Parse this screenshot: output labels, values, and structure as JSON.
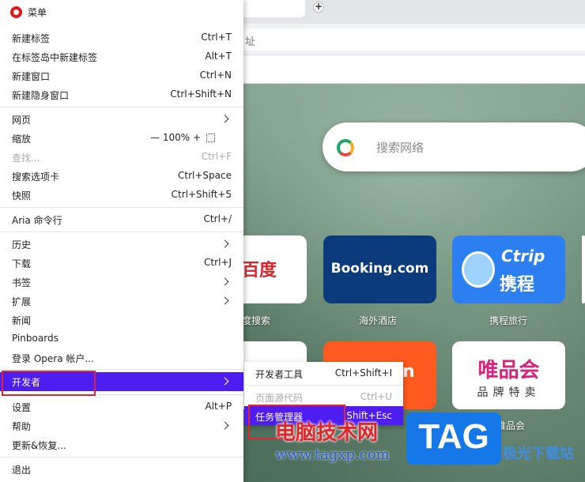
{
  "background": {
    "address_hint": "址",
    "search_placeholder": "搜索网络",
    "tiles": {
      "baidu": {
        "logo_text": "百度",
        "label": "度搜索"
      },
      "booking": {
        "logo_text": "Booking.com",
        "label": "海外酒店"
      },
      "ctrip": {
        "logo_en": "Ctrip",
        "logo_cn": "携程",
        "label": "携程旅行"
      },
      "orange": {
        "logo_text": "n"
      },
      "vip": {
        "logo_text": "唯品会",
        "sub_text": "品牌特卖",
        "label": "唯品会"
      }
    }
  },
  "menu": {
    "title": "菜单",
    "items": [
      {
        "label": "新建标签",
        "shortcut": "Ctrl+T"
      },
      {
        "label": "在标签岛中新建标签",
        "shortcut": "Alt+T"
      },
      {
        "label": "新建窗口",
        "shortcut": "Ctrl+N"
      },
      {
        "label": "新建隐身窗口",
        "shortcut": "Ctrl+Shift+N"
      },
      {
        "label": "网页",
        "shortcut": ""
      },
      {
        "label": "缩放",
        "shortcut": ""
      },
      {
        "label": "查找...",
        "shortcut": "Ctrl+F"
      },
      {
        "label": "搜索选项卡",
        "shortcut": "Ctrl+Space"
      },
      {
        "label": "快照",
        "shortcut": "Ctrl+Shift+5"
      },
      {
        "label": "Aria 命令行",
        "shortcut": "Ctrl+/"
      },
      {
        "label": "历史",
        "shortcut": ""
      },
      {
        "label": "下载",
        "shortcut": "Ctrl+J"
      },
      {
        "label": "书签",
        "shortcut": ""
      },
      {
        "label": "扩展",
        "shortcut": ""
      },
      {
        "label": "新闻",
        "shortcut": ""
      },
      {
        "label": "Pinboards",
        "shortcut": ""
      },
      {
        "label": "登录 Opera 帐户...",
        "shortcut": ""
      },
      {
        "label": "开发者",
        "shortcut": ""
      },
      {
        "label": "设置",
        "shortcut": "Alt+P"
      },
      {
        "label": "帮助",
        "shortcut": ""
      },
      {
        "label": "更新&恢复...",
        "shortcut": ""
      },
      {
        "label": "退出",
        "shortcut": ""
      }
    ],
    "zoom": {
      "minus": "—",
      "value": "100%",
      "plus": "+"
    }
  },
  "submenu": {
    "items": [
      {
        "label": "开发者工具",
        "shortcut": "Ctrl+Shift+I"
      },
      {
        "label": "页面源代码",
        "shortcut": "Ctrl+U"
      },
      {
        "label": "任务管理器",
        "shortcut": "Shift+Esc"
      }
    ]
  },
  "watermark": {
    "title": "电脑技术网",
    "url": "www.tagxp.com",
    "tag": "TAG",
    "tag_cn": "极光下载站"
  },
  "colors": {
    "highlight": "#4d1df2",
    "annotation_red": "#e0262d",
    "opera_red": "#e0181e"
  }
}
